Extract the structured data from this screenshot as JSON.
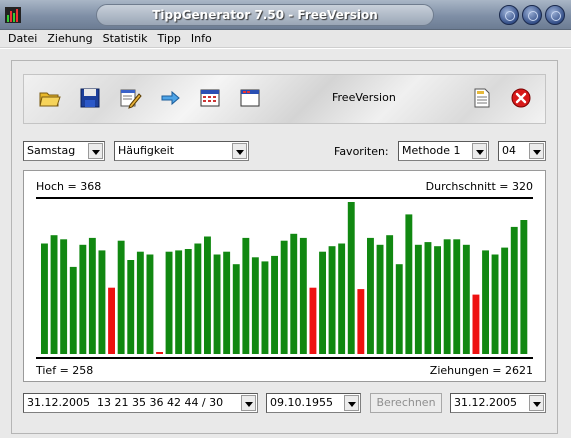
{
  "window": {
    "title": "TippGenerator 7.50 - FreeVersion"
  },
  "menu": [
    "Datei",
    "Ziehung",
    "Statistik",
    "Tipp",
    "Info"
  ],
  "toolbar": {
    "icons": [
      "open-folder-icon",
      "save-disk-icon",
      "edit-icon",
      "arrow-right-icon",
      "calendar-grid-icon",
      "window-icon",
      "document-icon",
      "close-red-icon"
    ],
    "version_label": "FreeVersion"
  },
  "filters": {
    "day": "Samstag",
    "mode": "Häufigkeit",
    "favorites_label": "Favoriten:",
    "method": "Methode 1",
    "number": "04"
  },
  "chart_data": {
    "type": "bar",
    "top_left_label": "Hoch = 368",
    "top_right_label": "Durchschnitt = 320",
    "bottom_left_label": "Tief = 258",
    "bottom_right_label": "Ziehungen = 2621",
    "colors": {
      "above": "#118811",
      "below": "#ee1111"
    },
    "ylim": [
      258,
      368
    ],
    "average": 320,
    "values": [
      338,
      344,
      341,
      321,
      337,
      342,
      333,
      306,
      340,
      326,
      332,
      330,
      258,
      332,
      333,
      334,
      338,
      343,
      330,
      332,
      323,
      342,
      328,
      325,
      329,
      340,
      345,
      342,
      306,
      332,
      336,
      338,
      368,
      305,
      342,
      337,
      344,
      323,
      359,
      337,
      339,
      336,
      341,
      341,
      337,
      301,
      333,
      330,
      335,
      350,
      355
    ]
  },
  "footer": {
    "draw_select": "31.12.2005  13 21 35 36 42 44 / 30",
    "start_date": "09.10.1955",
    "compute_label": "Berechnen",
    "end_date": "31.12.2005"
  }
}
